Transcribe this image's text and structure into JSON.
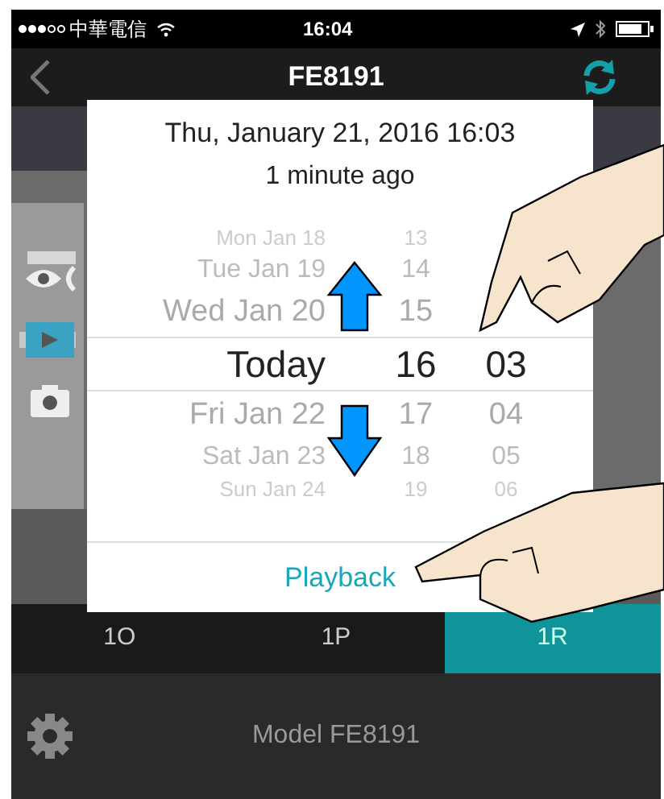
{
  "status_bar": {
    "carrier": "中華電信",
    "time": "16:04"
  },
  "nav_bar": {
    "title": "FE8191"
  },
  "side_controls": [
    {
      "kind": "eye",
      "selected": false
    },
    {
      "kind": "play",
      "selected": true
    },
    {
      "kind": "camera",
      "selected": false
    }
  ],
  "date_dialog": {
    "title": "Thu, January 21, 2016 16:03",
    "subtitle": "1 minute ago",
    "picker_rows": [
      {
        "day": "Mon Jan 18",
        "hour": "13",
        "selected": false
      },
      {
        "day": "Tue Jan 19",
        "hour": "14",
        "selected": false
      },
      {
        "day": "Wed Jan 20",
        "hour": "15",
        "selected": false
      },
      {
        "day": "Today",
        "hour": "16",
        "minute": "03",
        "selected": true
      },
      {
        "day": "Fri Jan 22",
        "hour": "17",
        "minute": "04",
        "selected": false
      },
      {
        "day": "Sat Jan 23",
        "hour": "18",
        "minute": "05",
        "selected": false
      },
      {
        "day": "Sun Jan 24",
        "hour": "19",
        "minute": "06",
        "selected": false
      }
    ],
    "action": "Playback"
  },
  "tabs": [
    {
      "label": "1O",
      "selected": false
    },
    {
      "label": "1P",
      "selected": false
    },
    {
      "label": "1R",
      "selected": true
    }
  ],
  "footer": {
    "model": "Model FE8191"
  }
}
